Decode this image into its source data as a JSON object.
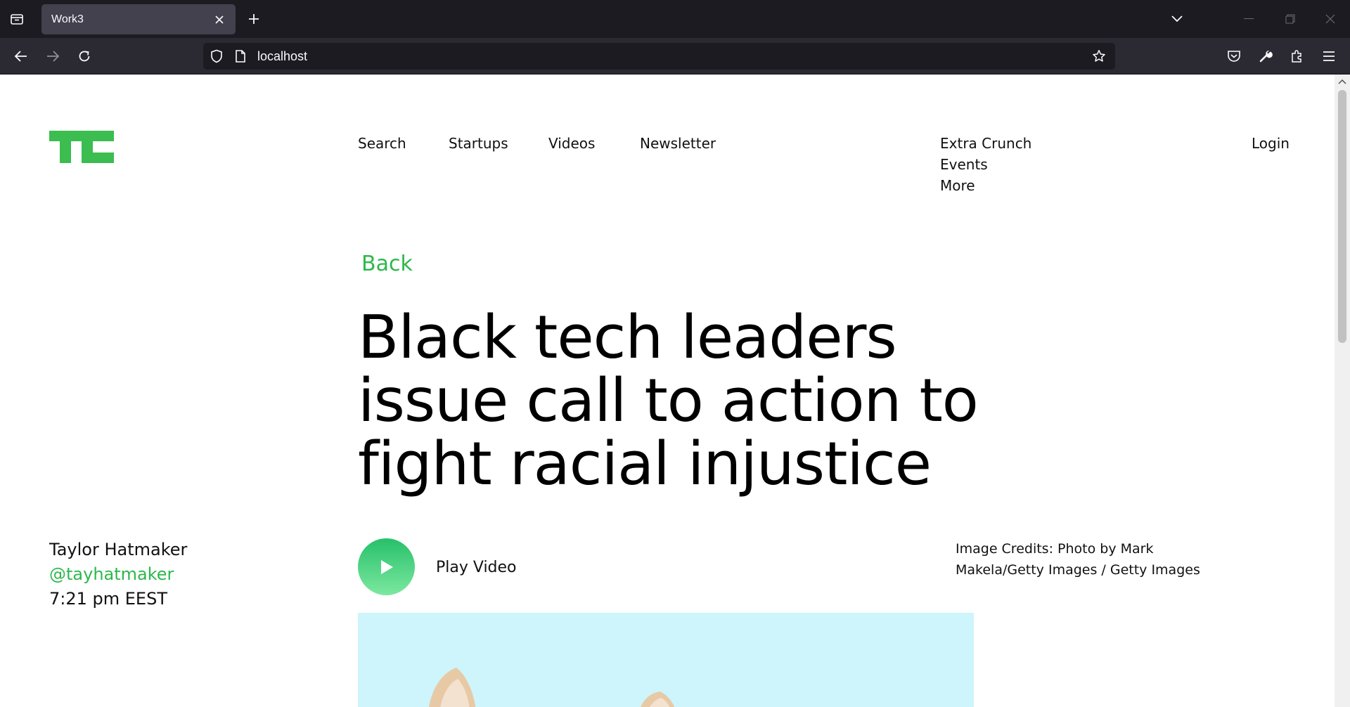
{
  "browser": {
    "tab_title": "Work3",
    "url": "localhost"
  },
  "site": {
    "logo": "TC",
    "nav_primary": [
      "Search",
      "Startups",
      "Videos",
      "Newsletter"
    ],
    "nav_secondary": [
      "Extra Crunch",
      "Events",
      "More"
    ],
    "login": "Login"
  },
  "article": {
    "back_label": "Back",
    "title": "Black tech leaders issue call to action to fight racial injustice",
    "author": {
      "name": "Taylor Hatmaker",
      "handle": "@tayhatmaker",
      "time": "7:21 pm EEST"
    },
    "play_video_label": "Play Video",
    "image_credits": "Image Credits: Photo by Mark Makela/Getty Images / Getty Images"
  },
  "colors": {
    "accent_green": "#2db84b",
    "tab_bar": "#1c1b22",
    "toolbar": "#2b2a33",
    "hero_bg": "#cdf5fb"
  },
  "icons": {
    "tab_list": "tab-list-icon",
    "new_tab": "plus-icon",
    "back": "arrow-left-icon",
    "forward": "arrow-right-icon",
    "reload": "reload-icon",
    "shield": "shield-icon",
    "page": "page-icon",
    "bookmark": "star-icon",
    "pocket": "pocket-icon",
    "tools": "wrench-icon",
    "extensions": "puzzle-icon",
    "menu": "hamburger-menu-icon",
    "play": "play-icon"
  }
}
